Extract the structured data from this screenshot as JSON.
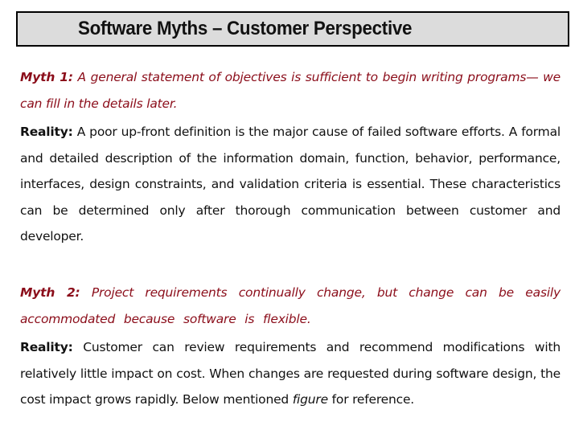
{
  "slide": {
    "title": "Software Myths – Customer Perspective",
    "myths": [
      {
        "label": "Myth 1:",
        "text": " A general statement of objectives is sufficient to begin writing programs— we can fill in the details later."
      },
      {
        "label": "Myth 2:",
        "text": " Project requirements continually change, but change can be easily accommodated because software is flexible."
      }
    ],
    "realities": [
      {
        "label": "Reality:",
        "text": " A poor up-front definition is the major cause of failed software efforts. A formal and detailed description of the information domain, function, behavior, performance, interfaces, design constraints, and validation criteria is essential. These characteristics can be determined only after thorough communication between customer and developer."
      },
      {
        "label": "Reality:",
        "text_before": " Customer can review requirements and recommend modifications with relatively little impact on cost. When changes are requested during software design, the cost impact grows rapidly. Below mentioned ",
        "emphasis": "figure",
        "text_after": " for reference."
      }
    ]
  },
  "colors": {
    "title_background": "#dcdcdc",
    "title_border": "#000000",
    "myth_text": "#8b0d1a",
    "body_text": "#111111"
  }
}
